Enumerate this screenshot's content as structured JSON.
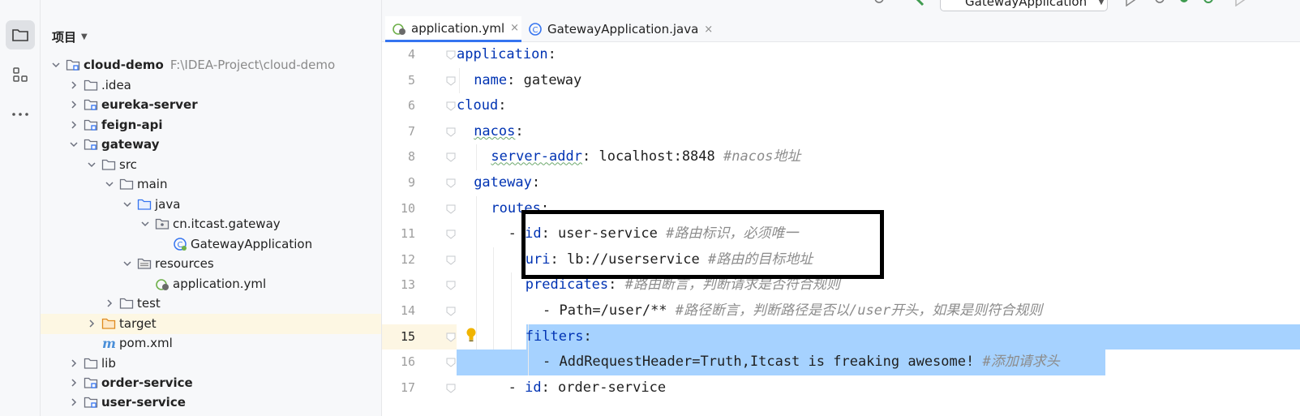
{
  "toolbar": {
    "run_config": "GatewayApplication"
  },
  "project_panel": {
    "title": "项目",
    "items": [
      {
        "label": "cloud-demo",
        "path": "F:\\IDEA-Project\\cloud-demo",
        "bold": true
      },
      {
        "label": ".idea"
      },
      {
        "label": "eureka-server",
        "bold": true
      },
      {
        "label": "feign-api",
        "bold": true
      },
      {
        "label": "gateway",
        "bold": true
      },
      {
        "label": "src"
      },
      {
        "label": "main"
      },
      {
        "label": "java"
      },
      {
        "label": "cn.itcast.gateway"
      },
      {
        "label": "GatewayApplication"
      },
      {
        "label": "resources"
      },
      {
        "label": "application.yml"
      },
      {
        "label": "test"
      },
      {
        "label": "target"
      },
      {
        "label": "pom.xml"
      },
      {
        "label": "lib"
      },
      {
        "label": "order-service",
        "bold": true
      },
      {
        "label": "user-service",
        "bold": true
      }
    ]
  },
  "tabs": [
    {
      "label": "application.yml",
      "close": "×",
      "active": true
    },
    {
      "label": "GatewayApplication.java",
      "close": "×",
      "active": false
    }
  ],
  "editor": {
    "lines": [
      {
        "no": "4",
        "key": "application",
        "colon": ":",
        "value": "",
        "comment": ""
      },
      {
        "no": "5",
        "key": "name",
        "colon": ":",
        "value": " gateway",
        "comment": ""
      },
      {
        "no": "6",
        "key": "cloud",
        "colon": ":",
        "value": "",
        "comment": ""
      },
      {
        "no": "7",
        "key": "nacos",
        "colon": ":",
        "value": "",
        "comment": ""
      },
      {
        "no": "8",
        "key": "server-addr",
        "colon": ":",
        "value": " localhost:8848 ",
        "comment": "#nacos地址"
      },
      {
        "no": "9",
        "key": "gateway",
        "colon": ":",
        "value": "",
        "comment": ""
      },
      {
        "no": "10",
        "key": "routes",
        "colon": ":",
        "value": "",
        "comment": ""
      },
      {
        "no": "11",
        "dash": "- ",
        "key": "id",
        "colon": ":",
        "value": " user-service ",
        "comment": "#路由标识，必须唯一"
      },
      {
        "no": "12",
        "key": "uri",
        "colon": ":",
        "value": " lb://userservice ",
        "comment": "#路由的目标地址"
      },
      {
        "no": "13",
        "key": "predicates",
        "colon": ":",
        "value": " ",
        "comment": "#路由断言，判断请求是否符合规则"
      },
      {
        "no": "14",
        "dash": "- ",
        "key": "",
        "colon": "",
        "value": "Path=/user/** ",
        "comment": "#路径断言，判断路径是否以/user开头，如果是则符合规则"
      },
      {
        "no": "15",
        "key": "filters",
        "colon": ":",
        "value": "",
        "comment": ""
      },
      {
        "no": "16",
        "dash": "- ",
        "key": "",
        "colon": "",
        "value": "AddRequestHeader=Truth,Itcast is freaking awesome! ",
        "comment": "#添加请求头"
      },
      {
        "no": "17",
        "dash": "- ",
        "key": "id",
        "colon": ":",
        "value": " order-service",
        "comment": ""
      }
    ]
  },
  "colors": {
    "key": "#0033b3",
    "comment": "#8c8c8c",
    "selection": "#a6d2ff",
    "tab_active_underline": "#3574f0"
  }
}
